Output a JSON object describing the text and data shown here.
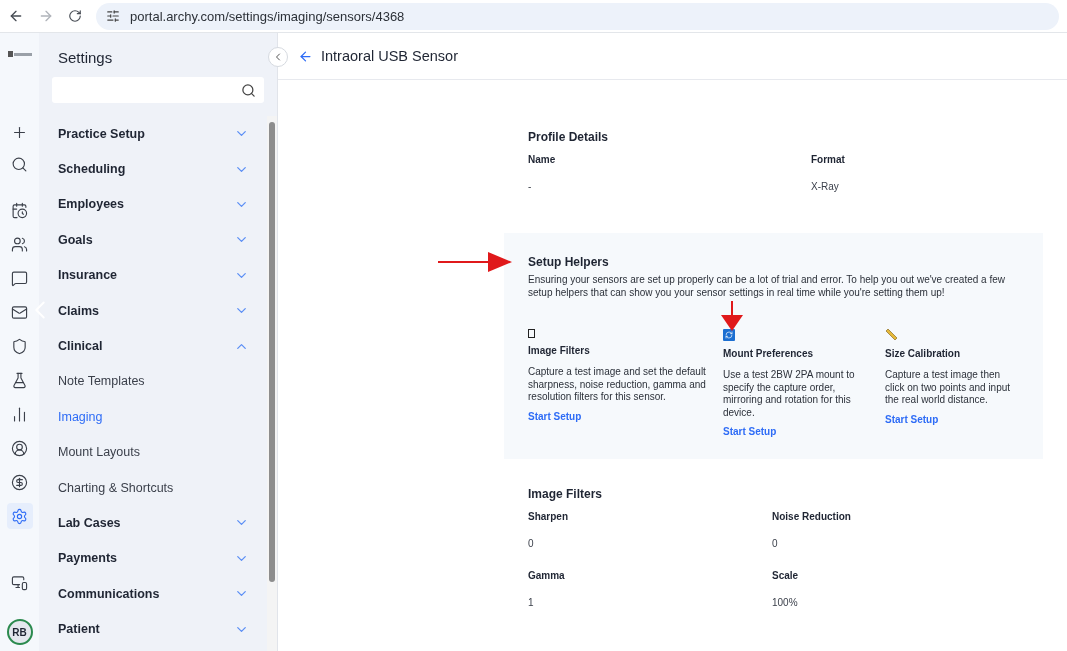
{
  "browser": {
    "url": "portal.archy.com/settings/imaging/sensors/4368"
  },
  "rail_items": [
    {
      "selected": false
    },
    {
      "selected": false
    },
    {
      "selected": false
    },
    {
      "selected": false
    },
    {
      "selected": false
    },
    {
      "selected": false
    },
    {
      "selected": false
    },
    {
      "selected": false
    },
    {
      "selected": false
    },
    {
      "selected": false
    },
    {
      "selected": false
    },
    {
      "selected": true
    },
    {
      "selected": false
    }
  ],
  "avatar": {
    "initials": "RB"
  },
  "sidebar": {
    "title": "Settings",
    "items": [
      {
        "label": "Practice Setup",
        "expanded": false
      },
      {
        "label": "Scheduling",
        "expanded": false
      },
      {
        "label": "Employees",
        "expanded": false
      },
      {
        "label": "Goals",
        "expanded": false
      },
      {
        "label": "Insurance",
        "expanded": false
      },
      {
        "label": "Claims",
        "expanded": false
      },
      {
        "label": "Clinical",
        "expanded": true,
        "children": [
          {
            "label": "Note Templates",
            "selected": false
          },
          {
            "label": "Imaging",
            "selected": true
          },
          {
            "label": "Mount Layouts",
            "selected": false
          },
          {
            "label": "Charting & Shortcuts",
            "selected": false
          }
        ]
      },
      {
        "label": "Lab Cases",
        "expanded": false
      },
      {
        "label": "Payments",
        "expanded": false
      },
      {
        "label": "Communications",
        "expanded": false
      },
      {
        "label": "Patient",
        "expanded": false
      }
    ]
  },
  "page": {
    "title": "Intraoral USB Sensor"
  },
  "profile_details": {
    "title": "Profile Details",
    "fields": [
      {
        "label": "Name",
        "value": "-"
      },
      {
        "label": "Format",
        "value": "X-Ray"
      }
    ]
  },
  "setup_helpers": {
    "title": "Setup Helpers",
    "description": "Ensuring your sensors are set up properly can be a lot of trial and error. To help you out we've created a few setup helpers that can show you your sensor settings in real time while you're setting them up!",
    "helpers": [
      {
        "title": "Image Filters",
        "description": "Capture a test image and set the default sharpness, noise reduction, gamma and resolution filters for this sensor.",
        "link": "Start Setup"
      },
      {
        "title": "Mount Preferences",
        "description": "Use a test 2BW 2PA mount to specify the capture order, mirroring and rotation for this device.",
        "link": "Start Setup"
      },
      {
        "title": "Size Calibration",
        "description": "Capture a test image then click on two points and input the real world distance.",
        "link": "Start Setup"
      }
    ]
  },
  "image_filters": {
    "title": "Image Filters",
    "fields": [
      {
        "label": "Sharpen",
        "value": "0"
      },
      {
        "label": "Noise Reduction",
        "value": "0"
      },
      {
        "label": "Gamma",
        "value": "1"
      },
      {
        "label": "Scale",
        "value": "100%"
      }
    ]
  }
}
